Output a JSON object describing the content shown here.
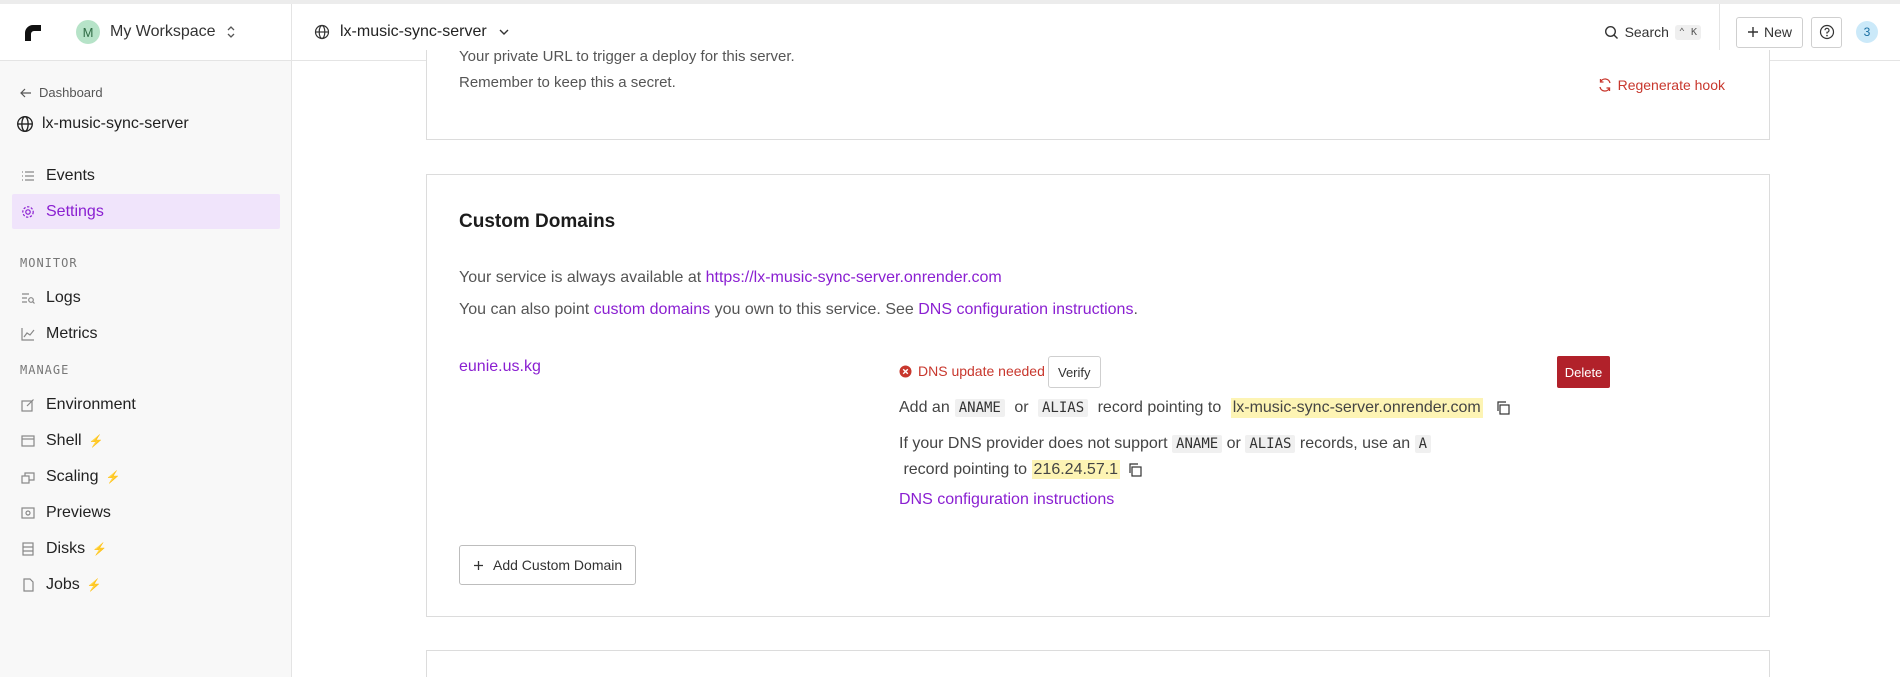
{
  "topbar": {
    "workspace_initial": "M",
    "workspace_name": "My Workspace",
    "service_name": "lx-music-sync-server",
    "search_label": "Search",
    "search_shortcut": "⌃ K",
    "new_label": "New",
    "notification_count": "3"
  },
  "sidebar": {
    "back_label": "Dashboard",
    "service_name": "lx-music-sync-server",
    "items": [
      {
        "label": "Events"
      },
      {
        "label": "Settings"
      },
      {
        "label": "Logs"
      },
      {
        "label": "Metrics"
      },
      {
        "label": "Environment"
      },
      {
        "label": "Shell"
      },
      {
        "label": "Scaling"
      },
      {
        "label": "Previews"
      },
      {
        "label": "Disks"
      },
      {
        "label": "Jobs"
      }
    ],
    "section_monitor": "MONITOR",
    "section_manage": "MANAGE",
    "active_item": "Settings"
  },
  "deploy_hook": {
    "line1": "Your private URL to trigger a deploy for this server.",
    "line2": "Remember to keep this a secret.",
    "regenerate_label": "Regenerate hook"
  },
  "custom_domains": {
    "title": "Custom Domains",
    "available_text": "Your service is always available at ",
    "service_url": "https://lx-music-sync-server.onrender.com",
    "point_text_1": "You can also point ",
    "custom_domains_link": "custom domains",
    "point_text_2": " you own to this service. See ",
    "dns_link": "DNS configuration instructions",
    "point_text_3": ".",
    "domain": "eunie.us.kg",
    "status": "DNS update needed",
    "verify_label": "Verify",
    "delete_label": "Delete",
    "rec1_prefix": "Add an ",
    "aname": "ANAME",
    "or": " or ",
    "alias": "ALIAS",
    "rec1_mid": " record pointing to ",
    "target_host": "lx-music-sync-server.onrender.com",
    "rec2_prefix": "If your DNS provider does not support ",
    "rec2_mid": " records, use an ",
    "a_record": "A",
    "rec2_suffix": " record pointing to ",
    "ip": "216.24.57.1",
    "instructions_link": "DNS configuration instructions",
    "add_domain_label": "Add Custom Domain"
  },
  "colors": {
    "accent": "#8a1fd1",
    "danger": "#b1212a",
    "highlight": "#fdf4b4"
  }
}
